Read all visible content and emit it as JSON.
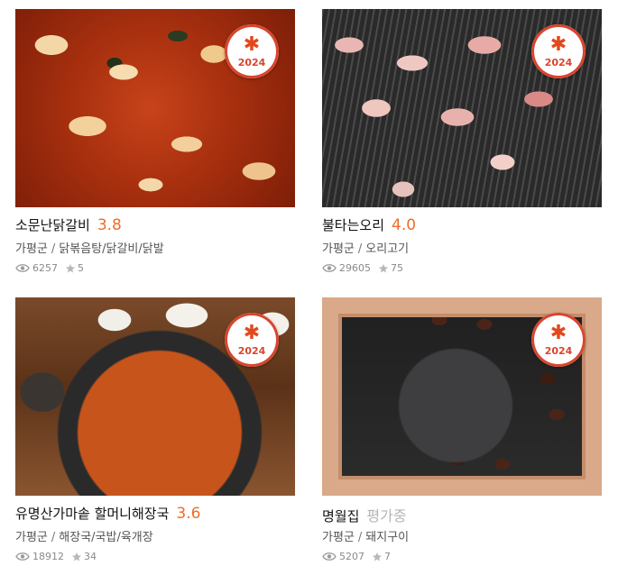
{
  "colors": {
    "score": "#f06c2a",
    "pending": "#b5b5b5",
    "badge": "#d9452e"
  },
  "badge_year": "2024",
  "restaurants": [
    {
      "name": "소문난닭갈비",
      "score": "3.8",
      "region": "가평군",
      "category": "닭볶음탕/닭갈비/닭발",
      "views": "6257",
      "favorites": "5",
      "badge_icon": "asterisk-icon"
    },
    {
      "name": "불타는오리",
      "score": "4.0",
      "region": "가평군",
      "category": "오리고기",
      "views": "29605",
      "favorites": "75",
      "badge_icon": "asterisk-icon"
    },
    {
      "name": "유명산가마솥 할머니해장국",
      "score": "3.6",
      "region": "가평군",
      "category": "해장국/국밥/육개장",
      "views": "18912",
      "favorites": "34",
      "badge_icon": "asterisk-icon"
    },
    {
      "name": "명월집",
      "score": "평가중",
      "region": "가평군",
      "category": "돼지구이",
      "views": "5207",
      "favorites": "7",
      "badge_icon": "asterisk-icon"
    }
  ]
}
